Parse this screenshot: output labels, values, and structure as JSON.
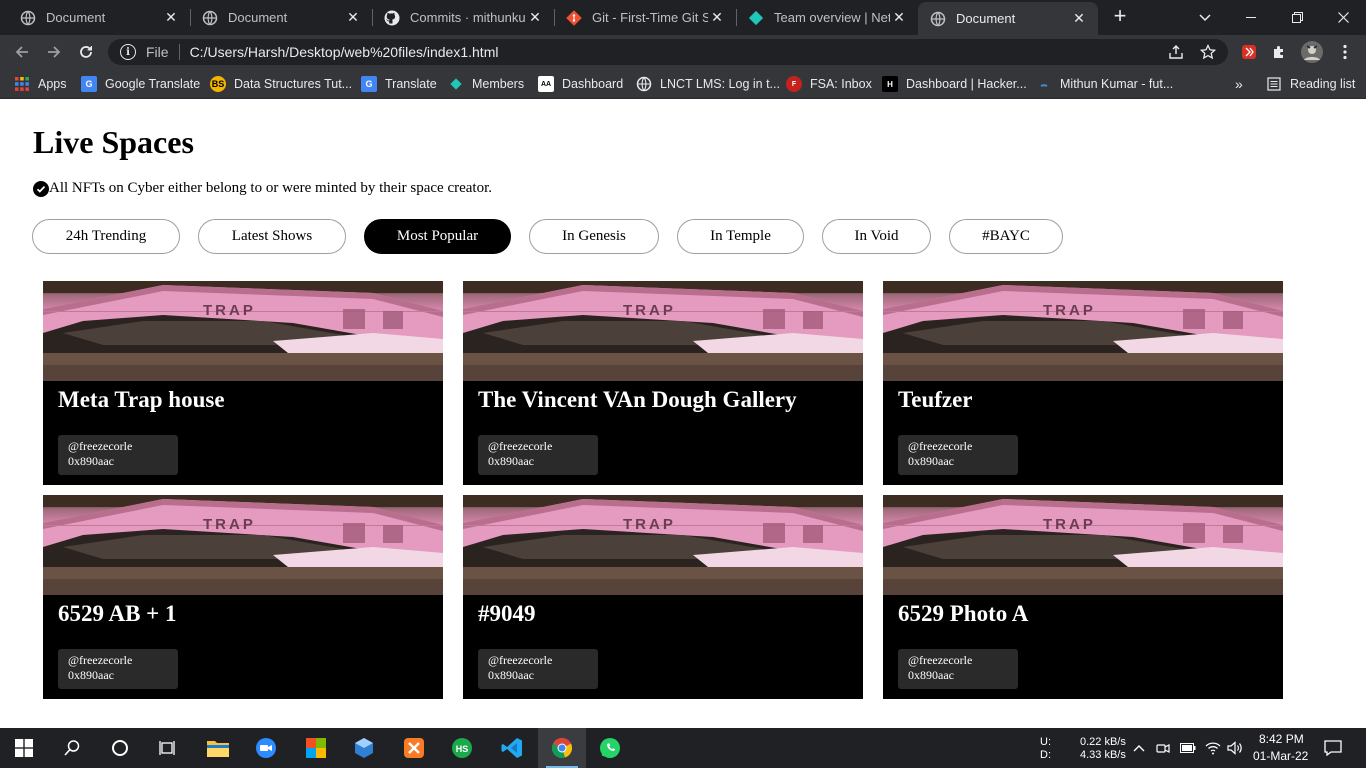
{
  "browser": {
    "tabs": [
      {
        "title": "Document",
        "icon": "globe-icon",
        "active": false
      },
      {
        "title": "Document",
        "icon": "globe-icon",
        "active": false
      },
      {
        "title": "Commits · mithunkum",
        "icon": "github-icon",
        "active": false
      },
      {
        "title": "Git - First-Time Git Set",
        "icon": "git-icon",
        "active": false
      },
      {
        "title": "Team overview | Netlif",
        "icon": "netlify-icon",
        "active": false
      },
      {
        "title": "Document",
        "icon": "globe-icon",
        "active": true
      }
    ],
    "address": {
      "scheme_label": "File",
      "url": "C:/Users/Harsh/Desktop/web%20files/index1.html"
    },
    "bookmarks": [
      {
        "label": "Apps",
        "icon": "apps-grid-icon"
      },
      {
        "label": "Google Translate",
        "icon": "google-translate-icon"
      },
      {
        "label": "Data Structures Tut...",
        "icon": "bs-icon"
      },
      {
        "label": "Translate",
        "icon": "translate-icon"
      },
      {
        "label": "Members",
        "icon": "netlify-icon"
      },
      {
        "label": "Dashboard",
        "icon": "dashboard-icon"
      },
      {
        "label": "LNCT LMS: Log in t...",
        "icon": "lms-icon"
      },
      {
        "label": "FSA: Inbox",
        "icon": "fsa-icon"
      },
      {
        "label": "Dashboard | Hacker...",
        "icon": "hackerrank-icon"
      },
      {
        "label": "Mithun Kumar - fut...",
        "icon": "bookmark-icon"
      }
    ],
    "reading_list_label": "Reading list"
  },
  "page": {
    "title": "Live Spaces",
    "notice": "All NFTs on Cyber either belong to or were minted by their space creator.",
    "filters": [
      {
        "label": "24h Trending",
        "active": false
      },
      {
        "label": "Latest Shows",
        "active": false
      },
      {
        "label": "Most Popular",
        "active": true
      },
      {
        "label": "In Genesis",
        "active": false
      },
      {
        "label": "In Temple",
        "active": false
      },
      {
        "label": "In Void",
        "active": false
      },
      {
        "label": "#BAYC",
        "active": false
      }
    ],
    "cards": [
      {
        "title": "Meta Trap house",
        "handle": "@freezecorle",
        "address": "0x890aac",
        "image_text": "TRAP"
      },
      {
        "title": "The Vincent VAn Dough Gallery",
        "handle": "@freezecorle",
        "address": "0x890aac",
        "image_text": "TRAP"
      },
      {
        "title": "Teufzer",
        "handle": "@freezecorle",
        "address": "0x890aac",
        "image_text": "TRAP"
      },
      {
        "title": "6529 AB + 1",
        "handle": "@freezecorle",
        "address": "0x890aac",
        "image_text": "TRAP"
      },
      {
        "title": "#9049",
        "handle": "@freezecorle",
        "address": "0x890aac",
        "image_text": "TRAP"
      },
      {
        "title": "6529 Photo A",
        "handle": "@freezecorle",
        "address": "0x890aac",
        "image_text": "TRAP"
      }
    ]
  },
  "taskbar": {
    "network": {
      "up_label": "U:",
      "down_label": "D:",
      "up": "0.22 kB/s",
      "down": "4.33 kB/s"
    },
    "time": "8:42 PM",
    "date": "01-Mar-22"
  }
}
